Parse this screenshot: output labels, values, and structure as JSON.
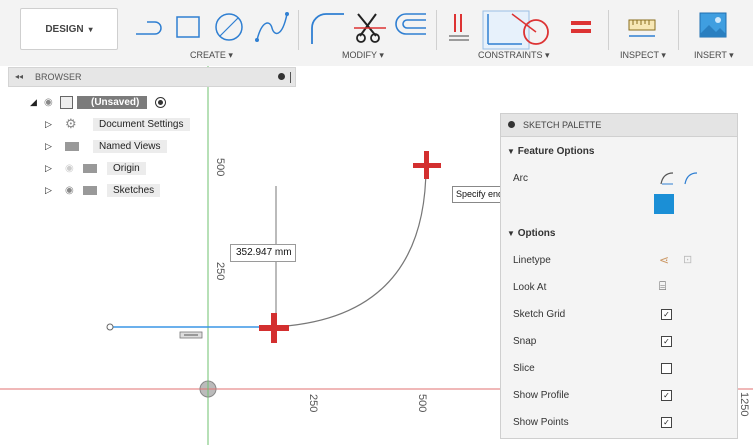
{
  "toolbar": {
    "workspace": "DESIGN",
    "groups": [
      {
        "label": "CREATE ▾"
      },
      {
        "label": "MODIFY ▾"
      },
      {
        "label": "CONSTRAINTS ▾"
      },
      {
        "label": "INSPECT ▾"
      },
      {
        "label": "INSERT ▾"
      }
    ]
  },
  "browser": {
    "title": "BROWSER",
    "root": "(Unsaved)",
    "items": [
      "Document Settings",
      "Named Views",
      "Origin",
      "Sketches"
    ]
  },
  "canvas": {
    "axis_labels": {
      "y_500": "500",
      "y_250": "250",
      "x_250": "250",
      "x_500": "500",
      "x_1250": "1250"
    },
    "dimension_value": "352.947 mm",
    "tooltip": "Specify end point"
  },
  "palette": {
    "title": "SKETCH PALETTE",
    "feature_options": "Feature Options",
    "arc_label": "Arc",
    "options": "Options",
    "rows": [
      {
        "label": "Linetype",
        "checked": null
      },
      {
        "label": "Look At",
        "checked": null
      },
      {
        "label": "Sketch Grid",
        "checked": true
      },
      {
        "label": "Snap",
        "checked": true
      },
      {
        "label": "Slice",
        "checked": false
      },
      {
        "label": "Show Profile",
        "checked": true
      },
      {
        "label": "Show Points",
        "checked": true
      }
    ],
    "check_glyph": "✓",
    "accent_color": "#1b8fd6"
  },
  "colors": {
    "sketch_line": "#3a95e6",
    "axis_green": "#6fc06f",
    "axis_red": "#e07070",
    "marker_red": "#d32f2f"
  }
}
